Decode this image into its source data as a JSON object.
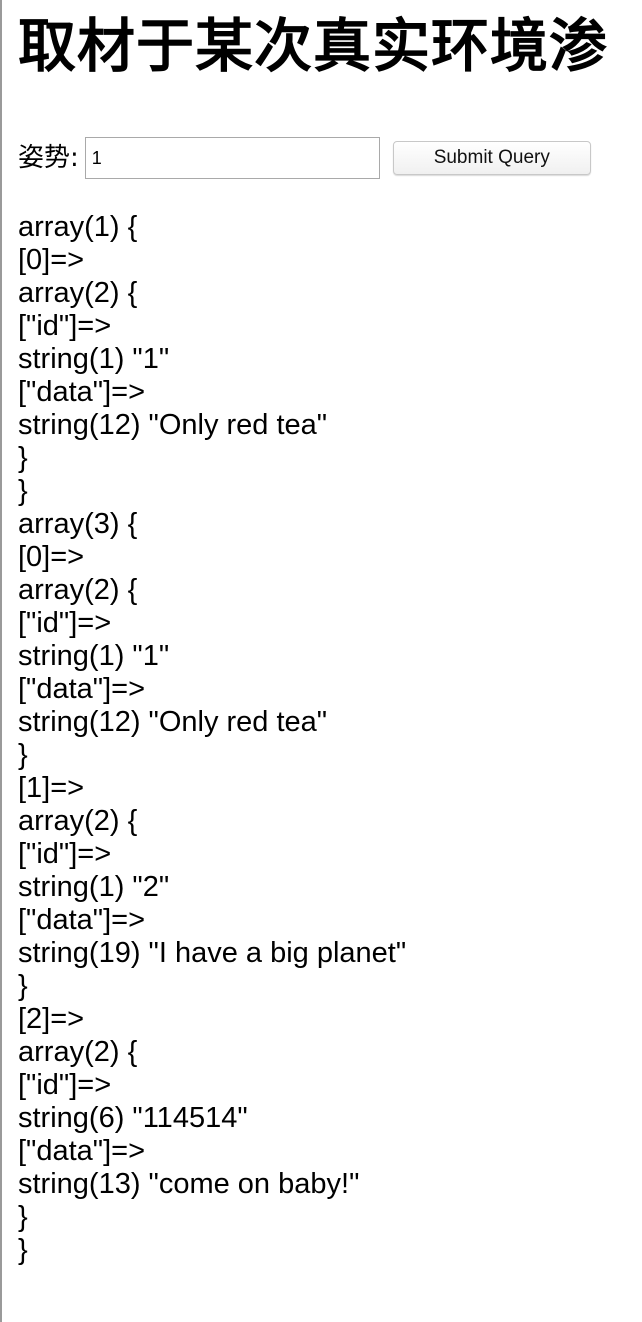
{
  "page": {
    "heading": "取材于某次真实环境渗"
  },
  "form": {
    "label": "姿势:",
    "input_value": "1",
    "submit_label": "Submit Query"
  },
  "output": {
    "lines": [
      "array(1) {",
      "[0]=>",
      "array(2) {",
      "[\"id\"]=>",
      "string(1) \"1\"",
      "[\"data\"]=>",
      "string(12) \"Only red tea\"",
      "}",
      "}",
      "array(3) {",
      "[0]=>",
      "array(2) {",
      "[\"id\"]=>",
      "string(1) \"1\"",
      "[\"data\"]=>",
      "string(12) \"Only red tea\"",
      "}",
      "[1]=>",
      "array(2) {",
      "[\"id\"]=>",
      "string(1) \"2\"",
      "[\"data\"]=>",
      "string(19) \"I have a big planet\"",
      "}",
      "[2]=>",
      "array(2) {",
      "[\"id\"]=>",
      "string(6) \"114514\"",
      "[\"data\"]=>",
      "string(13) \"come on baby!\"",
      "}",
      "}"
    ]
  }
}
